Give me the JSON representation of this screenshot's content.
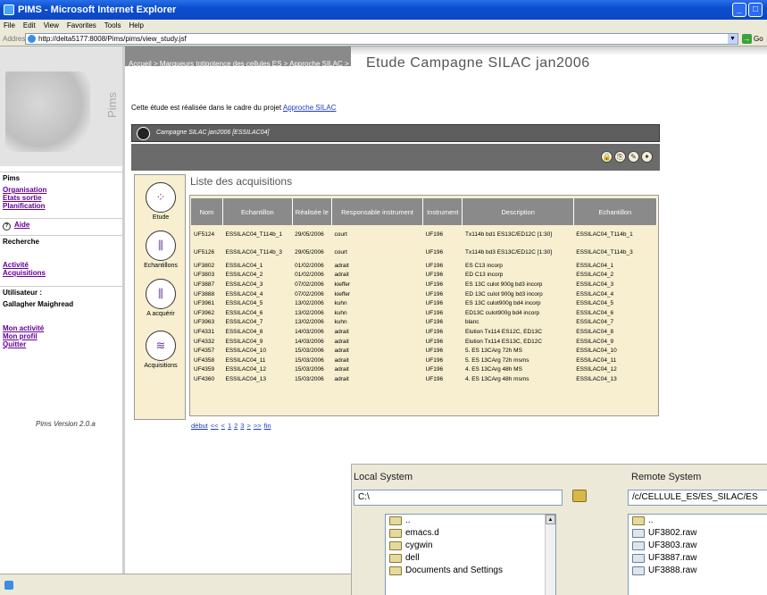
{
  "window": {
    "title": "PIMS - Microsoft Internet Explorer"
  },
  "menu": [
    "File",
    "Edit",
    "View",
    "Favorites",
    "Tools",
    "Help"
  ],
  "address": {
    "label": "Address",
    "url": "http://delta5177:8008/Pims/pims/view_study.jsf",
    "go_label": "Go"
  },
  "sidebar": {
    "brand": "Pims",
    "pims_heading": "Pims",
    "links1": [
      "Organisation",
      "Etats sortie",
      "Planification"
    ],
    "help": "Aide",
    "search_heading": "Recherche",
    "links2": [
      "Activité",
      "Acquisitions"
    ],
    "user_label": "Utilisateur :",
    "user_name": "Gallagher Maighread",
    "links3": [
      "Mon activité",
      "Mon profil",
      "Quitter"
    ],
    "version": "Pims Version 2.0.a"
  },
  "breadcrumb": [
    "Accueil",
    "Marqueurs totipotence des cellules ES",
    "Approche SILAC"
  ],
  "page_title": "Etude Campagne SILAC jan2006",
  "intro": {
    "text": "Cette étude est réalisée dans le cadre du projet ",
    "link": "Approche SILAC"
  },
  "study_bar": "Campagne SILAC jan2006  [ESSILAC04]",
  "nav": [
    {
      "label": "Etude",
      "icon": "study-icon"
    },
    {
      "label": "Echantillons",
      "icon": "samples-icon"
    },
    {
      "label": "A acquérir",
      "icon": "to-acquire-icon"
    },
    {
      "label": "Acquisitions",
      "icon": "acquisitions-icon"
    }
  ],
  "list_title": "Liste des acquisitions",
  "table": {
    "headers": [
      "Nom",
      "Echantillon",
      "Réalisée le",
      "Responsable instrument",
      "Instrument",
      "Description",
      "Echantillon"
    ],
    "rows": [
      [
        "UF5124",
        "ESSILAC04_T114b_1",
        "29/05/2006",
        "court",
        "UF196",
        "Tx114b bd1 ES13C/ED12C [1:30]",
        "ESSILAC04_T114b_1"
      ],
      [
        "UF5126",
        "ESSILAC04_T114b_3",
        "29/05/2006",
        "court",
        "UF196",
        "Tx114b bd3 ES13C/ED12C [1:30]",
        "ESSILAC04_T114b_3"
      ],
      [
        "UF3802",
        "ESSILAC04_1",
        "01/02/2006",
        "adrait",
        "UF196",
        "ES C13 incorp",
        "ESSILAC04_1"
      ],
      [
        "UF3803",
        "ESSILAC04_2",
        "01/02/2006",
        "adrait",
        "UF196",
        "ED C13 incorp",
        "ESSILAC04_2"
      ],
      [
        "UF3887",
        "ESSILAC04_3",
        "07/02/2006",
        "kieffer",
        "UF196",
        "ES 13C culot 900g bd3 incorp",
        "ESSILAC04_3"
      ],
      [
        "UF3888",
        "ESSILAC04_4",
        "07/02/2006",
        "kieffer",
        "UF196",
        "ED 13C culot 900g bd3 incorp",
        "ESSILAC04_4"
      ],
      [
        "UF3961",
        "ESSILAC04_5",
        "13/02/2006",
        "kuhn",
        "UF196",
        "ES 13C culot900g bd4 incorp",
        "ESSILAC04_5"
      ],
      [
        "UF3962",
        "ESSILAC04_6",
        "13/02/2006",
        "kuhn",
        "UF196",
        "ED13C culot900g bd4 incorp",
        "ESSILAC04_6"
      ],
      [
        "UF3963",
        "ESSILAC04_7",
        "13/02/2006",
        "kuhn",
        "UF196",
        "blanc",
        "ESSILAC04_7"
      ],
      [
        "UF4331",
        "ESSILAC04_8",
        "14/03/2006",
        "adrait",
        "UF196",
        "Elution Tx114 ES12C, ED13C",
        "ESSILAC04_8"
      ],
      [
        "UF4332",
        "ESSILAC04_9",
        "14/03/2006",
        "adrait",
        "UF196",
        "Elution Tx114 ES13C, ED12C",
        "ESSILAC04_9"
      ],
      [
        "UF4357",
        "ESSILAC04_10",
        "15/03/2006",
        "adrait",
        "UF196",
        "5. ES 13CArg 72h MS",
        "ESSILAC04_10"
      ],
      [
        "UF4358",
        "ESSILAC04_11",
        "15/03/2006",
        "adrait",
        "UF196",
        "5. ES 13CArg 72h msms",
        "ESSILAC04_11"
      ],
      [
        "UF4359",
        "ESSILAC04_12",
        "15/03/2006",
        "adrait",
        "UF196",
        "4. ES 13CArg 48h MS",
        "ESSILAC04_12"
      ],
      [
        "UF4360",
        "ESSILAC04_13",
        "15/03/2006",
        "adrait",
        "UF196",
        "4. ES 13CArg 48h msms",
        "ESSILAC04_13"
      ]
    ]
  },
  "pager": [
    "début",
    "<<",
    "<",
    "1",
    "2",
    "3",
    ">",
    ">>",
    "fin"
  ],
  "ftp": {
    "local_label": "Local System",
    "local_path": "C:\\",
    "local_items": [
      "..",
      "emacs.d",
      "cygwin",
      "dell",
      "Documents and Settings"
    ],
    "remote_label": "Remote System",
    "remote_path": "/c/CELLULE_ES/ES_SILAC/ES",
    "remote_items": [
      "..",
      "UF3802.raw",
      "UF3803.raw",
      "UF3887.raw",
      "UF3888.raw"
    ]
  }
}
